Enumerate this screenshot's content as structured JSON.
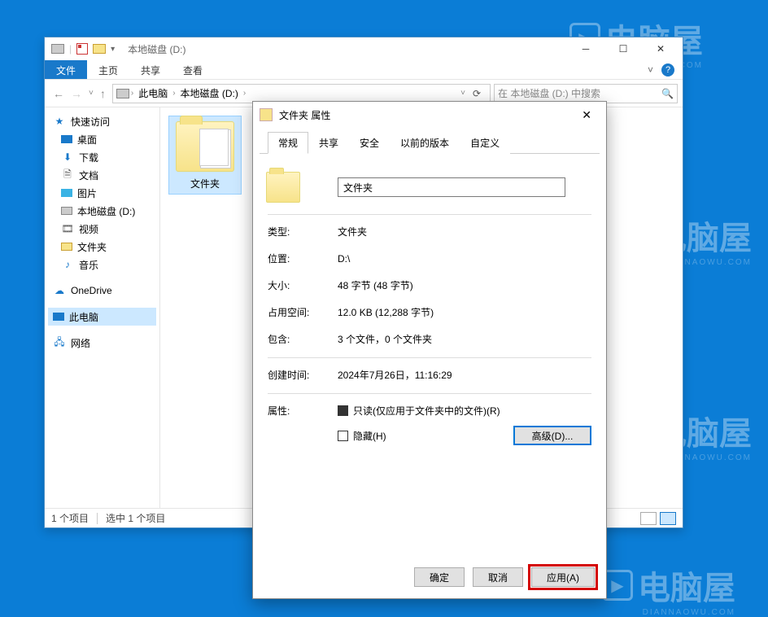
{
  "watermark": {
    "text": "电脑屋",
    "sub": "DIANNAOWU.COM"
  },
  "explorer": {
    "title": "本地磁盘 (D:)",
    "ribbon": {
      "file": "文件",
      "home": "主页",
      "share": "共享",
      "view": "查看"
    },
    "nav": {
      "thispc": "此电脑",
      "drive": "本地磁盘 (D:)"
    },
    "search_placeholder": "在 本地磁盘 (D:) 中搜索",
    "sidebar": {
      "quick": "快速访问",
      "desktop": "桌面",
      "downloads": "下载",
      "documents": "文档",
      "pictures": "图片",
      "localdisk": "本地磁盘 (D:)",
      "videos": "视频",
      "folder": "文件夹",
      "music": "音乐",
      "onedrive": "OneDrive",
      "thispc": "此电脑",
      "network": "网络"
    },
    "content": {
      "folder_name": "文件夹"
    },
    "status": {
      "count": "1 个项目",
      "selected": "选中 1 个项目"
    }
  },
  "props": {
    "title": "文件夹 属性",
    "tabs": {
      "general": "常规",
      "sharing": "共享",
      "security": "安全",
      "prev": "以前的版本",
      "custom": "自定义"
    },
    "name_value": "文件夹",
    "rows": {
      "type_lbl": "类型:",
      "type_val": "文件夹",
      "loc_lbl": "位置:",
      "loc_val": "D:\\",
      "size_lbl": "大小:",
      "size_val": "48 字节 (48 字节)",
      "disk_lbl": "占用空间:",
      "disk_val": "12.0 KB (12,288 字节)",
      "contains_lbl": "包含:",
      "contains_val": "3 个文件，0 个文件夹",
      "created_lbl": "创建时间:",
      "created_val": "2024年7月26日，11:16:29",
      "attr_lbl": "属性:",
      "readonly": "只读(仅应用于文件夹中的文件)(R)",
      "hidden": "隐藏(H)",
      "advanced": "高级(D)..."
    },
    "buttons": {
      "ok": "确定",
      "cancel": "取消",
      "apply": "应用(A)"
    }
  }
}
